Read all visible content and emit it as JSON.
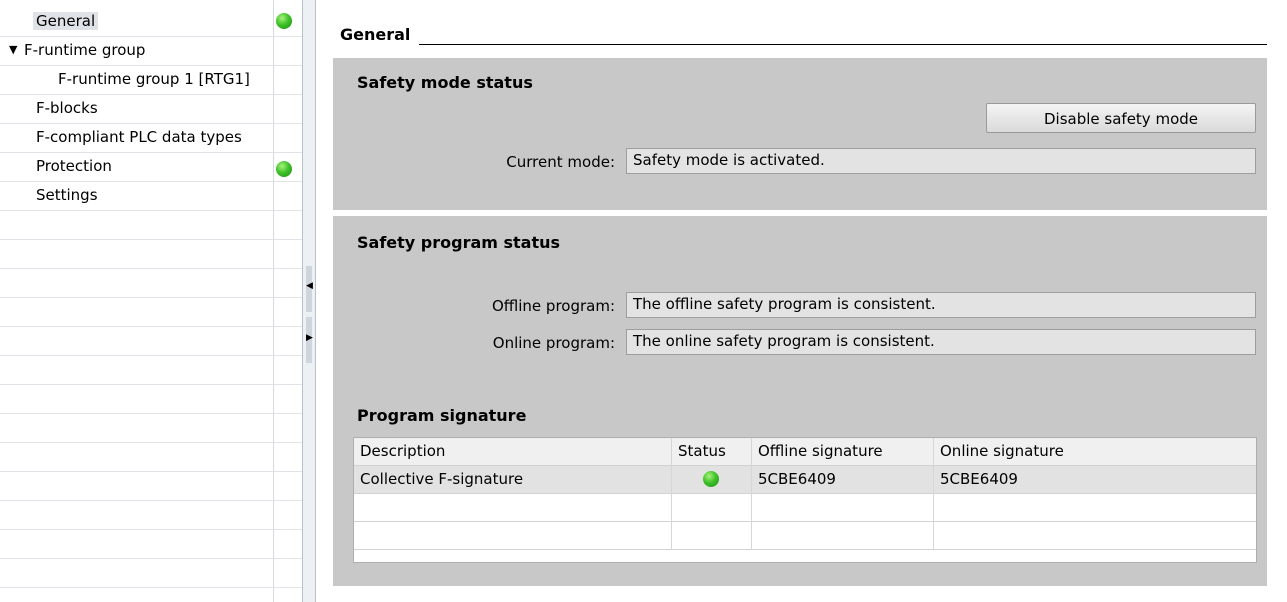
{
  "nav": {
    "items": [
      {
        "label": "General",
        "status": "ok"
      },
      {
        "label": "F-runtime group"
      },
      {
        "label": "F-runtime group 1 [RTG1]"
      },
      {
        "label": "F-blocks"
      },
      {
        "label": "F-compliant PLC data types"
      },
      {
        "label": "Protection",
        "status": "ok"
      },
      {
        "label": "Settings"
      }
    ]
  },
  "page": {
    "title": "General"
  },
  "safety_mode": {
    "title": "Safety mode status",
    "button_label": "Disable safety mode",
    "current_mode_label": "Current mode:",
    "current_mode_value": "Safety mode is activated."
  },
  "safety_program": {
    "title": "Safety program status",
    "offline_label": "Offline program:",
    "offline_value": "The offline safety program is consistent.",
    "online_label": "Online program:",
    "online_value": "The online safety program is consistent."
  },
  "signature": {
    "title": "Program signature",
    "columns": [
      "Description",
      "Status",
      "Offline signature",
      "Online signature"
    ],
    "rows": [
      {
        "description": "Collective F-signature",
        "status": "ok",
        "offline": "5CBE6409",
        "online": "5CBE6409"
      }
    ]
  },
  "colors": {
    "status_ok": "#3fc22a",
    "panel_bg": "#c8c8c8"
  }
}
